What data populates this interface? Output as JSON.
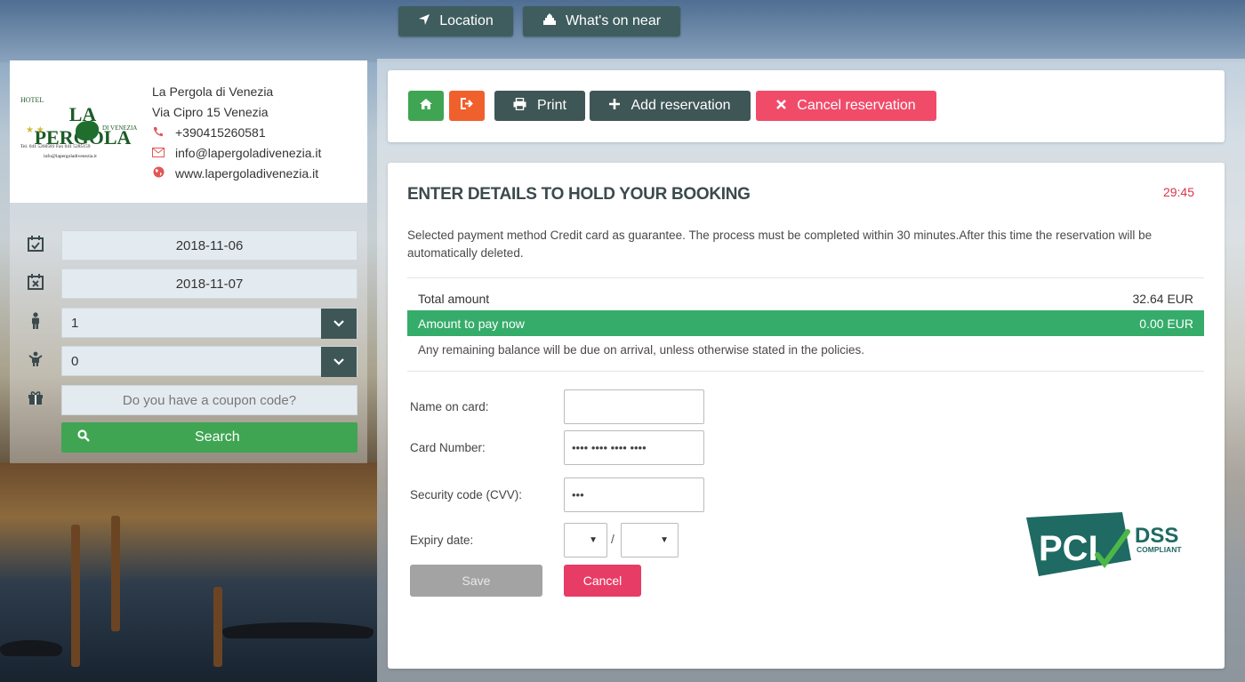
{
  "top_nav": {
    "location_label": "Location",
    "whats_on_label": "What's on near"
  },
  "hotel": {
    "logo_title": "LA PERGOLA",
    "logo_sub": "HOTEL",
    "logo_di": "DI VENEZIA",
    "logo_tel": "Tel. 041 5260581      Fax 041 5285159",
    "logo_email": "info@lapergoladivenezia.it",
    "name": "La Pergola di Venezia",
    "address": "Via Cipro 15 Venezia",
    "phone": "+390415260581",
    "email": "info@lapergoladivenezia.it",
    "website": "www.lapergoladivenezia.it"
  },
  "search": {
    "checkin": "2018-11-06",
    "checkout": "2018-11-07",
    "adults": "1",
    "children": "0",
    "coupon_placeholder": "Do you have a coupon code?",
    "search_label": "Search"
  },
  "toolbar": {
    "print_label": "Print",
    "add_label": "Add reservation",
    "cancel_label": "Cancel reservation"
  },
  "booking": {
    "heading": "ENTER DETAILS TO HOLD YOUR BOOKING",
    "timer": "29:45",
    "notice": "Selected payment method Credit card as guarantee. The process must be completed within 30 minutes.After this time the reservation will be automatically deleted.",
    "total_label": "Total amount",
    "total_value": "32.64 EUR",
    "pay_now_label": "Amount to pay now",
    "pay_now_value": "0.00 EUR",
    "remaining": "Any remaining balance will be due on arrival, unless otherwise stated in the policies."
  },
  "card_form": {
    "name_label": "Name on card:",
    "name_value": "",
    "number_label": "Card Number:",
    "number_placeholder": "•••• •••• •••• ••••",
    "cvv_label": "Security code (CVV):",
    "cvv_placeholder": "•••",
    "expiry_label": "Expiry date:",
    "expiry_separator": "/",
    "save_label": "Save",
    "cancel_label": "Cancel"
  },
  "pci": {
    "pci_text": "PCI",
    "dss_text": "DSS",
    "compliant_text": "COMPLIANT"
  },
  "colors": {
    "green": "#3fa552",
    "orange": "#f0602d",
    "dark_teal": "#3f5656",
    "pink": "#e73c66",
    "timer_red": "#d9354f",
    "pay_green": "#36ac6b"
  }
}
